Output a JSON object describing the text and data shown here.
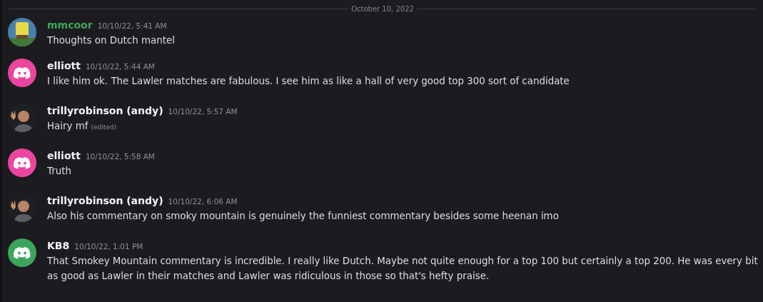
{
  "date_divider": "October 10, 2022",
  "messages": [
    {
      "author": "mmcoor",
      "color": "#3ba55c",
      "timestamp": "10/10/22, 5:41 AM",
      "text": "Thoughts on Dutch mantel"
    },
    {
      "author": "elliott",
      "color": "#f2f3f5",
      "avatar": {
        "kind": "logo",
        "color": "#eb459f"
      },
      "timestamp": "10/10/22, 5:44 AM",
      "text": "I like him ok. The Lawler matches are fabulous. I see him as like a hall of very good top 300 sort of candidate"
    },
    {
      "author": "trillyrobinson (andy)",
      "color": "#f2f3f5",
      "timestamp": "10/10/22, 5:57 AM",
      "text": "Hairy mf",
      "edited_label": "(edited)"
    },
    {
      "author": "elliott",
      "color": "#f2f3f5",
      "avatar": {
        "kind": "logo",
        "color": "#eb459f"
      },
      "timestamp": "10/10/22, 5:58 AM",
      "text": "Truth"
    },
    {
      "author": "trillyrobinson (andy)",
      "color": "#f2f3f5",
      "timestamp": "10/10/22, 6:06 AM",
      "text": "Also his commentary on smoky mountain is genuinely the funniest commentary besides some heenan imo"
    },
    {
      "author": "KB8",
      "color": "#f2f3f5",
      "avatar": {
        "kind": "logo",
        "color": "#3ba55d"
      },
      "timestamp": "10/10/22, 1:01 PM",
      "text": "That Smokey Mountain commentary is incredible. I really like Dutch. Maybe not quite enough for a top 100 but certainly a top 200. He was every bit as good as Lawler in their matches and Lawler was ridiculous in those so that's hefty praise."
    }
  ]
}
